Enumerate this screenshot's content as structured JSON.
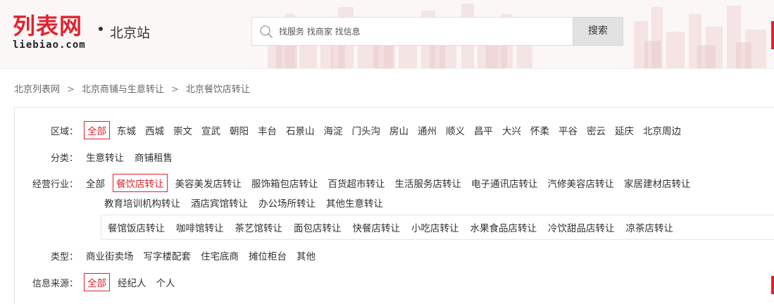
{
  "header": {
    "logo_cn": "列表网",
    "logo_en": "liebiao.com",
    "city": "北京站",
    "search_placeholder": "找服务 找商家 找信息",
    "search_button": "搜索"
  },
  "breadcrumb": [
    "北京列表网",
    "北京商铺与生意转让",
    "北京餐饮店转让"
  ],
  "breadcrumb_sep": ">",
  "filters": {
    "area": {
      "label": "区域：",
      "options": [
        "全部",
        "东城",
        "西城",
        "崇文",
        "宣武",
        "朝阳",
        "丰台",
        "石景山",
        "海淀",
        "门头沟",
        "房山",
        "通州",
        "顺义",
        "昌平",
        "大兴",
        "怀柔",
        "平谷",
        "密云",
        "延庆",
        "北京周边"
      ],
      "active": "全部"
    },
    "category": {
      "label": "分类：",
      "options": [
        "生意转让",
        "商铺租售"
      ]
    },
    "industry": {
      "label": "经营行业：",
      "options_row1": [
        "全部",
        "餐饮店转让",
        "美容美发店转让",
        "服饰箱包店转让",
        "百货超市转让",
        "生活服务店转让",
        "电子通讯店转让",
        "汽修美容店转让",
        "家居建材店转让"
      ],
      "options_row2": [
        "教育培训机构转让",
        "酒店宾馆转让",
        "办公场所转让",
        "其他生意转让"
      ],
      "active": "餐饮店转让",
      "sub_options": [
        "餐馆饭店转让",
        "咖啡馆转让",
        "茶艺馆转让",
        "面包店转让",
        "快餐店转让",
        "小吃店转让",
        "水果食品店转让",
        "冷饮甜品店转让",
        "凉茶店转让"
      ]
    },
    "type": {
      "label": "类型：",
      "options": [
        "商业街卖场",
        "写字楼配套",
        "住宅底商",
        "摊位柜台",
        "其他"
      ]
    },
    "source": {
      "label": "信息来源：",
      "options": [
        "全部",
        "经纪人",
        "个人"
      ],
      "active": "全部"
    }
  },
  "colors": {
    "brand": "#e0232e",
    "text": "#333333",
    "border": "#e5e5e5"
  }
}
